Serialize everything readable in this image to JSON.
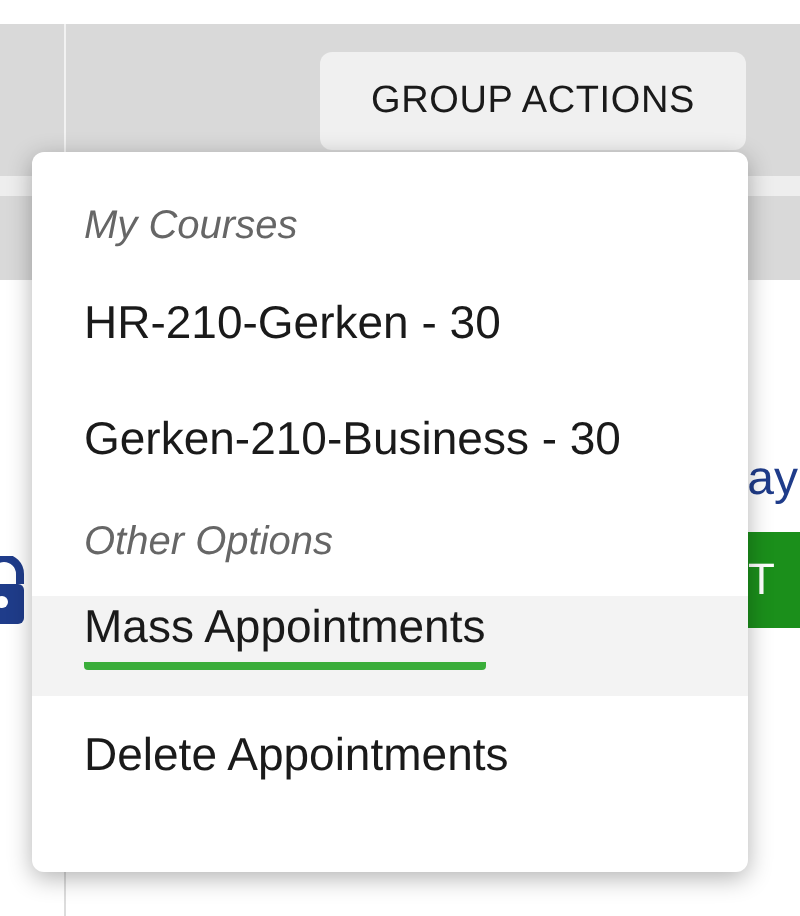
{
  "toolbar": {
    "button": "GROUP ACTIONS"
  },
  "background": {
    "link_text": "ay",
    "green_button": "T"
  },
  "menu": [
    {
      "kind": "header",
      "label": "My Courses"
    },
    {
      "kind": "option",
      "label": "HR-210-Gerken - 30",
      "selected": false
    },
    {
      "kind": "option",
      "label": "Gerken-210-Business - 30",
      "selected": false
    },
    {
      "kind": "header",
      "label": "Other Options"
    },
    {
      "kind": "option",
      "label": "Mass Appointments",
      "selected": true
    },
    {
      "kind": "option",
      "label": "Delete Appointments",
      "selected": false
    }
  ]
}
